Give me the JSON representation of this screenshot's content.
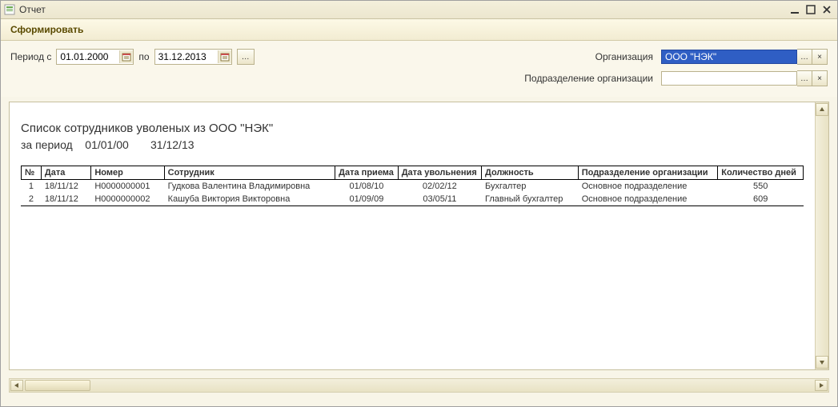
{
  "window": {
    "title": "Отчет"
  },
  "toolbar": {
    "generate": "Сформировать"
  },
  "filters": {
    "period_from_label": "Период с",
    "period_from": "01.01.2000",
    "period_to_label": "по",
    "period_to": "31.12.2013",
    "org_label": "Организация",
    "org_value": "ООО \"НЭК\"",
    "dept_label": "Подразделение организации",
    "dept_value": ""
  },
  "report": {
    "title": "Список сотрудников уволеных из ООО \"НЭК\"",
    "period_label": "за период",
    "period_from_display": "01/01/00",
    "period_to_display": "31/12/13",
    "columns": {
      "n": "№",
      "date": "Дата",
      "number": "Номер",
      "employee": "Сотрудник",
      "hire_date": "Дата приема",
      "fire_date": "Дата увольнения",
      "position": "Должность",
      "department": "Подразделение организации",
      "days": "Количество дней"
    },
    "rows": [
      {
        "n": "1",
        "date": "18/11/12",
        "number": "H0000000001",
        "employee": "Гудкова Валентина Владимировна",
        "hire": "01/08/10",
        "fire": "02/02/12",
        "position": "Бухгалтер",
        "dept": "Основное подразделение",
        "days": "550"
      },
      {
        "n": "2",
        "date": "18/11/12",
        "number": "H0000000002",
        "employee": "Кашуба Виктория Викторовна",
        "hire": "01/09/09",
        "fire": "03/05/11",
        "position": "Главный бухгалтер",
        "dept": "Основное подразделение",
        "days": "609"
      }
    ]
  }
}
